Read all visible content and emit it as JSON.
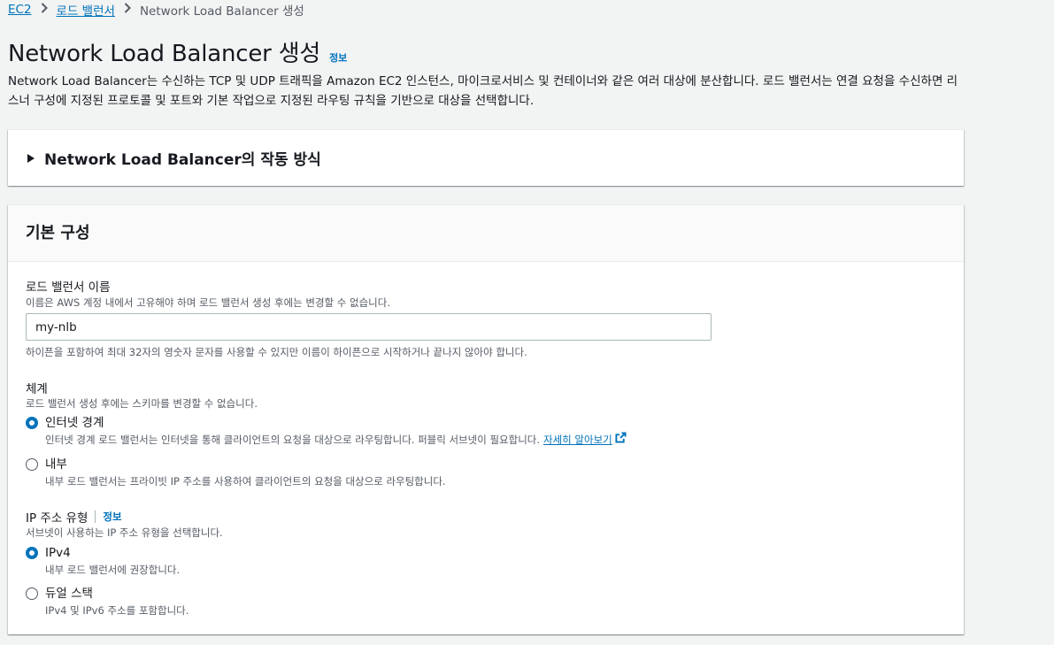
{
  "breadcrumb": {
    "items": [
      "EC2",
      "로드 밸런서"
    ],
    "current": "Network Load Balancer 생성"
  },
  "header": {
    "title": "Network Load Balancer 생성",
    "info": "정보",
    "description": "Network Load Balancer는 수신하는 TCP 및 UDP 트래픽을 Amazon EC2 인스턴스, 마이크로서비스 및 컨테이너와 같은 여러 대상에 분산합니다. 로드 밸런서는 연결 요청을 수신하면 리스너 구성에 지정된 프로토콜 및 포트와 기본 작업으로 지정된 라우팅 규칙을 기반으로 대상을 선택합니다."
  },
  "how_it_works": {
    "title": "Network Load Balancer의 작동 방식"
  },
  "basic_config": {
    "title": "기본 구성",
    "name_field": {
      "label": "로드 밸런서 이름",
      "description": "이름은 AWS 계정 내에서 고유해야 하며 로드 밸런서 생성 후에는 변경할 수 없습니다.",
      "value": "my-nlb",
      "constraint": "하이픈을 포함하여 최대 32자의 영숫자 문자를 사용할 수 있지만 이름이 하이픈으로 시작하거나 끝나지 않아야 합니다."
    },
    "scheme": {
      "label": "체계",
      "description": "로드 밸런서 생성 후에는 스키마를 변경할 수 없습니다.",
      "options": [
        {
          "label": "인터넷 경계",
          "description": "인터넷 경계 로드 밸런서는 인터넷을 통해 클라이언트의 요청을 대상으로 라우팅합니다. 퍼블릭 서브넷이 필요합니다.",
          "link": "자세히 알아보기",
          "selected": true
        },
        {
          "label": "내부",
          "description": "내부 로드 밸런서는 프라이빗 IP 주소를 사용하여 클라이언트의 요청을 대상으로 라우팅합니다.",
          "selected": false
        }
      ]
    },
    "ip_type": {
      "label": "IP 주소 유형",
      "info": "정보",
      "description": "서브넷이 사용하는 IP 주소 유형을 선택합니다.",
      "options": [
        {
          "label": "IPv4",
          "description": "내부 로드 밸런서에 권장합니다.",
          "selected": true
        },
        {
          "label": "듀얼 스택",
          "description": "IPv4 및 IPv6 주소를 포함합니다.",
          "selected": false
        }
      ]
    }
  },
  "colors": {
    "link": "#0073bb",
    "text": "#16191f",
    "muted": "#545b64",
    "bg": "#f2f3f3"
  }
}
